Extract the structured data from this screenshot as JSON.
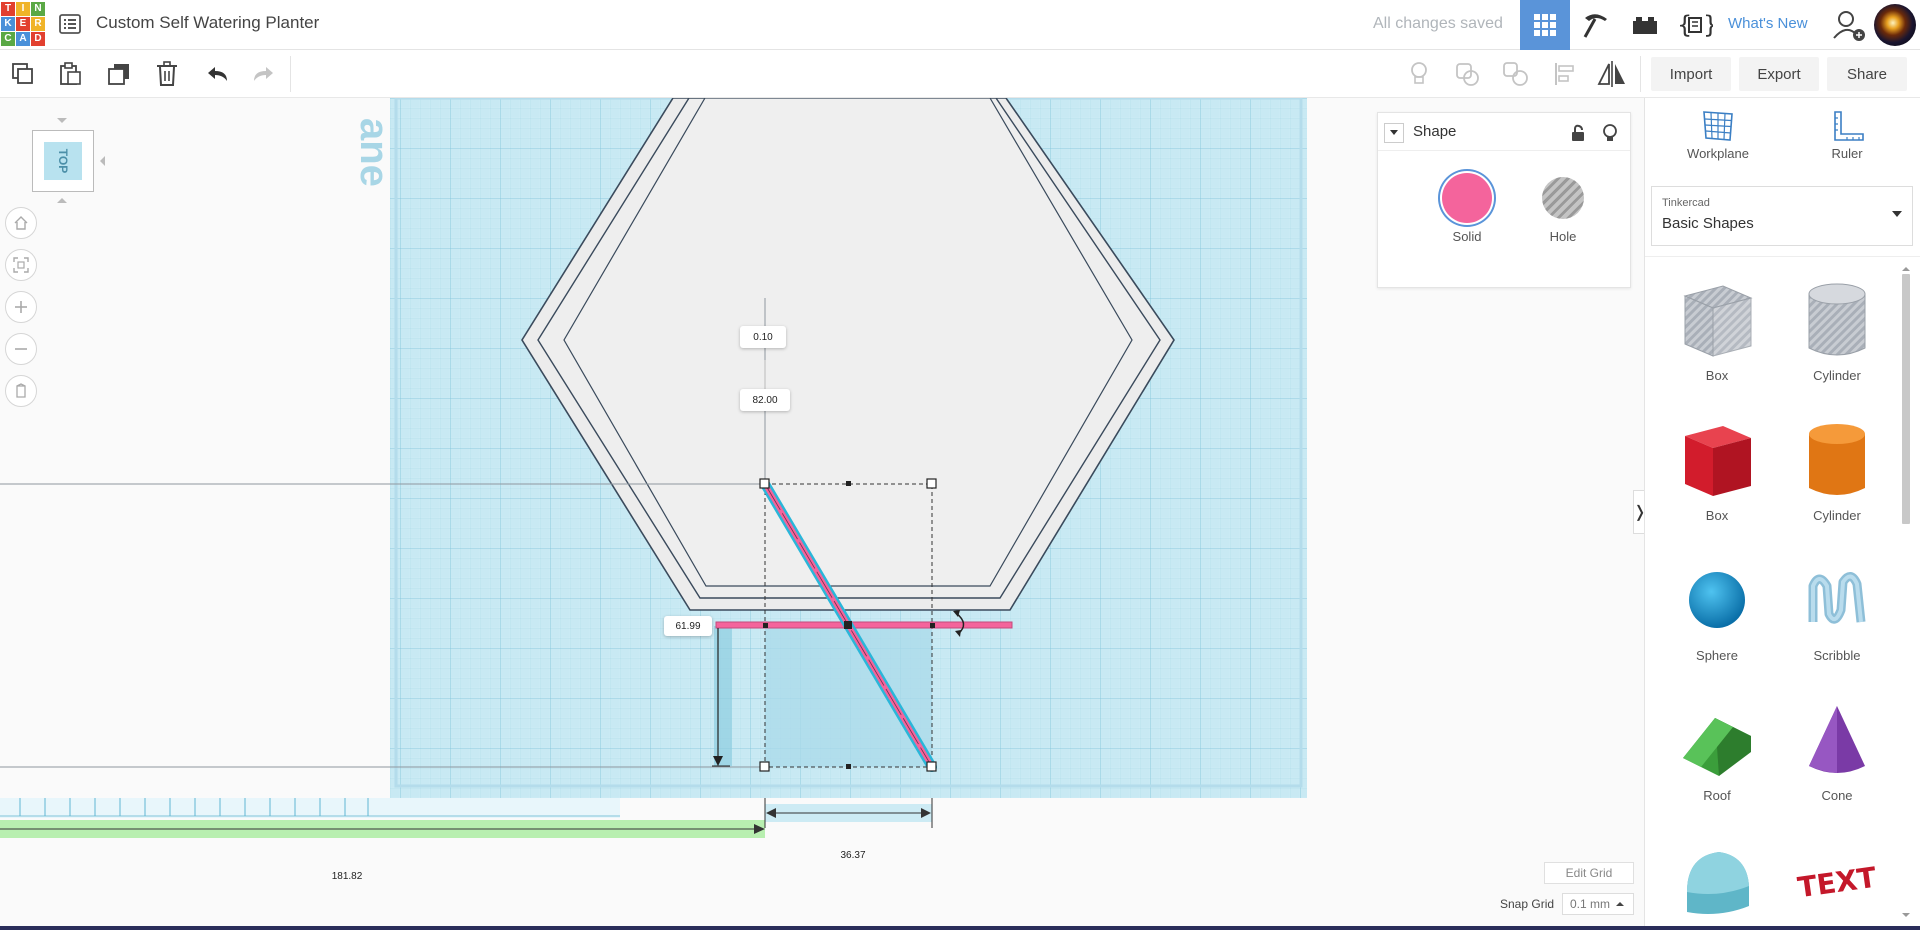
{
  "app": {
    "logo_letters": [
      "T",
      "I",
      "N",
      "K",
      "E",
      "R",
      "C",
      "A",
      "D"
    ],
    "logo_colors": [
      "#e2402f",
      "#f0b429",
      "#5aa845",
      "#4a90d9",
      "#e2402f",
      "#f0b429",
      "#5aa845",
      "#4a90d9",
      "#e2402f"
    ],
    "design_title": "Custom Self Watering Planter",
    "save_status": "All changes saved",
    "whats_new": "What's New",
    "accent_color": "#5a94d9"
  },
  "topbar_icons": [
    "grid-view-icon",
    "pickaxe-icon",
    "bricks-icon",
    "codeblocks-icon",
    "add-user-icon",
    "avatar"
  ],
  "toolbar": {
    "tools": [
      "copy-icon",
      "paste-icon",
      "duplicate-icon",
      "delete-icon",
      "undo-icon",
      "redo-icon"
    ],
    "right_tools": [
      "note-icon",
      "group-icon",
      "ungroup-icon",
      "align-icon",
      "mirror-icon"
    ],
    "import_label": "Import",
    "export_label": "Export",
    "share_label": "Share"
  },
  "viewcube": {
    "face_label": "TOP"
  },
  "workplane_watermark": "ane",
  "dimensions": {
    "elevation": "0.10",
    "height": "82.00",
    "width": "61.99",
    "length": "36.37",
    "distance": "181.82"
  },
  "inspector": {
    "title": "Shape",
    "solid_label": "Solid",
    "hole_label": "Hole",
    "solid_color": "#f4649c"
  },
  "grid": {
    "edit_label": "Edit Grid",
    "snap_label": "Snap Grid",
    "snap_value": "0.1 mm"
  },
  "right_panel": {
    "workplane_label": "Workplane",
    "ruler_label": "Ruler",
    "library_caption": "Tinkercad",
    "library_name": "Basic Shapes",
    "shapes": [
      {
        "label": "Box"
      },
      {
        "label": "Cylinder"
      },
      {
        "label": "Box"
      },
      {
        "label": "Cylinder"
      },
      {
        "label": "Sphere"
      },
      {
        "label": "Scribble"
      },
      {
        "label": "Roof"
      },
      {
        "label": "Cone"
      },
      {
        "label": ""
      },
      {
        "label": ""
      }
    ],
    "text_shape_word": "TEXT"
  }
}
